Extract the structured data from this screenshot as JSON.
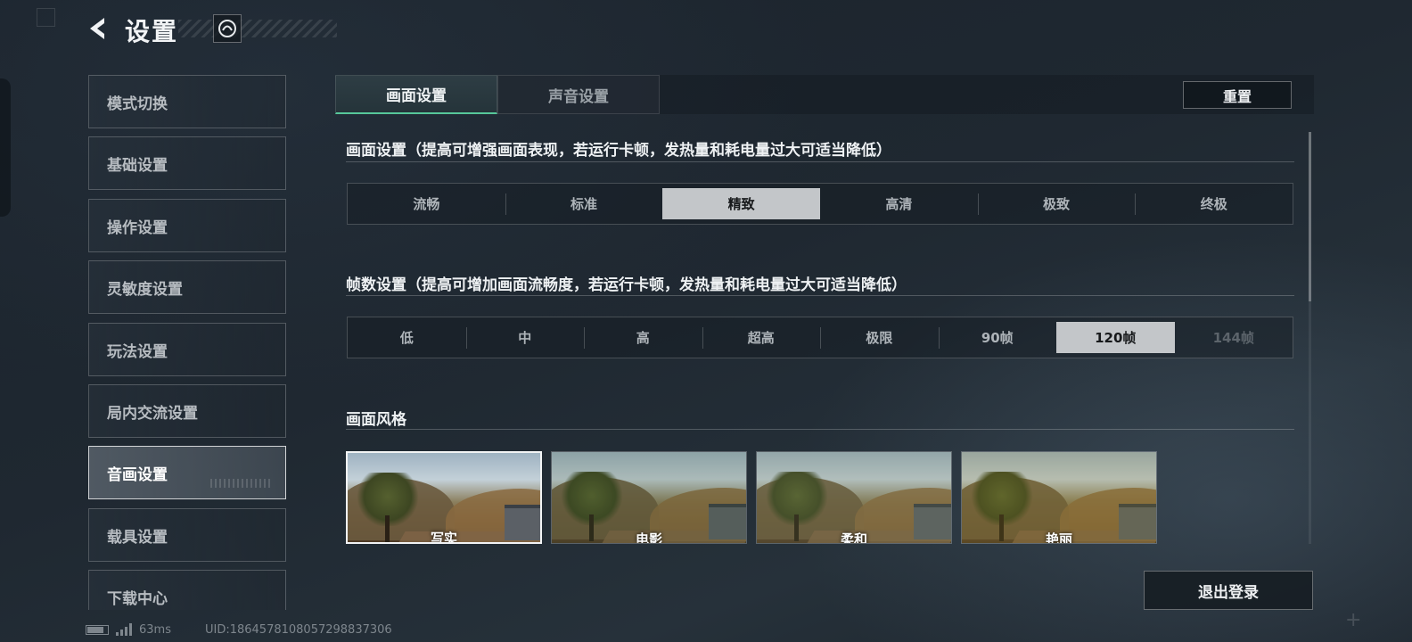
{
  "header": {
    "title": "设置"
  },
  "sidebar": {
    "items": [
      {
        "label": "模式切换",
        "active": false
      },
      {
        "label": "基础设置",
        "active": false
      },
      {
        "label": "操作设置",
        "active": false
      },
      {
        "label": "灵敏度设置",
        "active": false
      },
      {
        "label": "玩法设置",
        "active": false
      },
      {
        "label": "局内交流设置",
        "active": false
      },
      {
        "label": "音画设置",
        "active": true
      },
      {
        "label": "载具设置",
        "active": false
      },
      {
        "label": "下载中心",
        "active": false
      }
    ]
  },
  "tabs": [
    {
      "label": "画面设置",
      "active": true
    },
    {
      "label": "声音设置",
      "active": false
    }
  ],
  "reset_label": "重置",
  "graphics": {
    "title": "画面设置（提高可增强画面表现，若运行卡顿，发热量和耗电量过大可适当降低）",
    "options": [
      "流畅",
      "标准",
      "精致",
      "高清",
      "极致",
      "终极"
    ],
    "selected": "精致"
  },
  "framerate": {
    "title": "帧数设置（提高可增加画面流畅度，若运行卡顿，发热量和耗电量过大可适当降低）",
    "options": [
      "低",
      "中",
      "高",
      "超高",
      "极限",
      "90帧",
      "120帧",
      "144帧"
    ],
    "selected": "120帧",
    "disabled": [
      "144帧"
    ]
  },
  "style": {
    "title": "画面风格",
    "options": [
      {
        "label": "写实",
        "tint": "#000000",
        "selected": true
      },
      {
        "label": "电影",
        "tint": "#3b5a2a",
        "selected": false
      },
      {
        "label": "柔和",
        "tint": "#6b7a4a",
        "selected": false
      },
      {
        "label": "艳丽",
        "tint": "#8a7a20",
        "selected": false
      }
    ]
  },
  "logout_label": "退出登录",
  "status": {
    "ping": "63ms",
    "uid": "UID:1864578108057298837306"
  },
  "colors": {
    "accent": "#57c79a",
    "selected_option_bg": "#c3c6c9"
  }
}
